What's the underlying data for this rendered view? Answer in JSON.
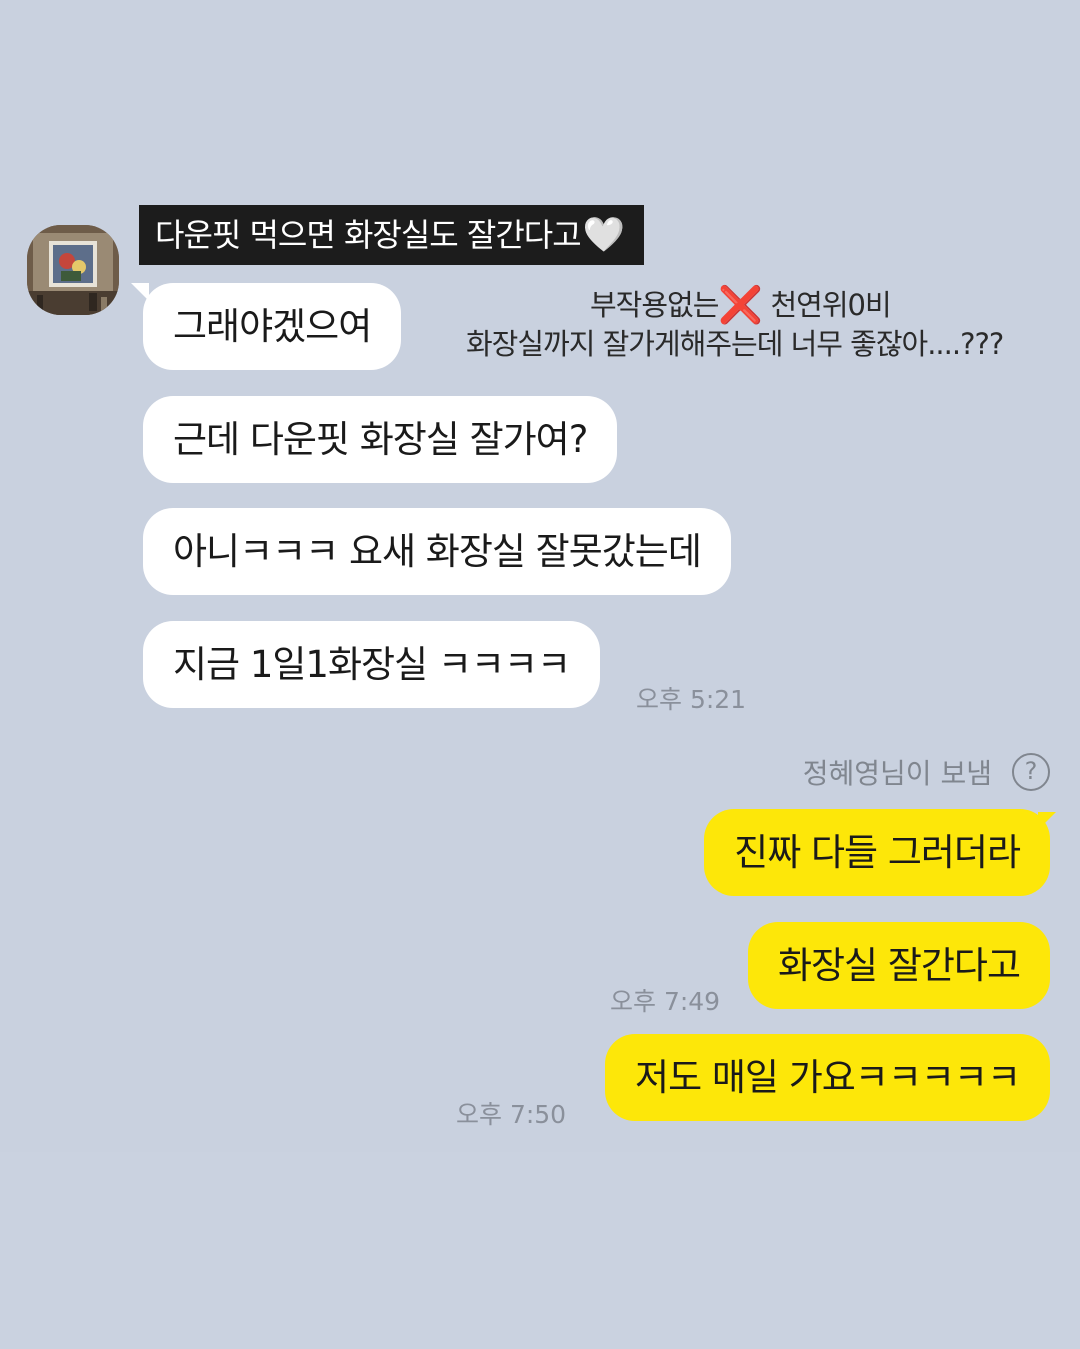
{
  "caption": {
    "text": "다운핏 먹으면 화장실도 잘간다고",
    "heart": "🤍"
  },
  "annotation": {
    "line1_before": "부작용없는",
    "line1_mark": "❌",
    "line1_after": " 천연위0비",
    "line2": "화장실까지 잘가게해주는데 너무 좋잖아....???"
  },
  "incoming": [
    {
      "text": "그래야겠으여"
    },
    {
      "text": "근데 다운핏 화장실 잘가여?"
    },
    {
      "text": "아니ㅋㅋㅋ 요새 화장실 잘못갔는데"
    },
    {
      "text": "지금 1일1화장실 ㅋㅋㅋㅋ"
    }
  ],
  "incoming_time": "오후 5:21",
  "sender_note": {
    "text": "정혜영님이 보냄",
    "icon": "question-icon",
    "icon_glyph": "?"
  },
  "outgoing": [
    {
      "text": "진짜 다들 그러더라"
    },
    {
      "text": "화장실 잘간다고",
      "time": "오후 7:49"
    },
    {
      "text": "저도 매일 가요ㅋㅋㅋㅋㅋ",
      "time": "오후 7:50"
    }
  ],
  "colors": {
    "background": "#c9d1df",
    "incoming_bubble": "#ffffff",
    "outgoing_bubble": "#fde709",
    "caption_bg": "#1c1c1c",
    "x_mark": "#e0221b"
  }
}
